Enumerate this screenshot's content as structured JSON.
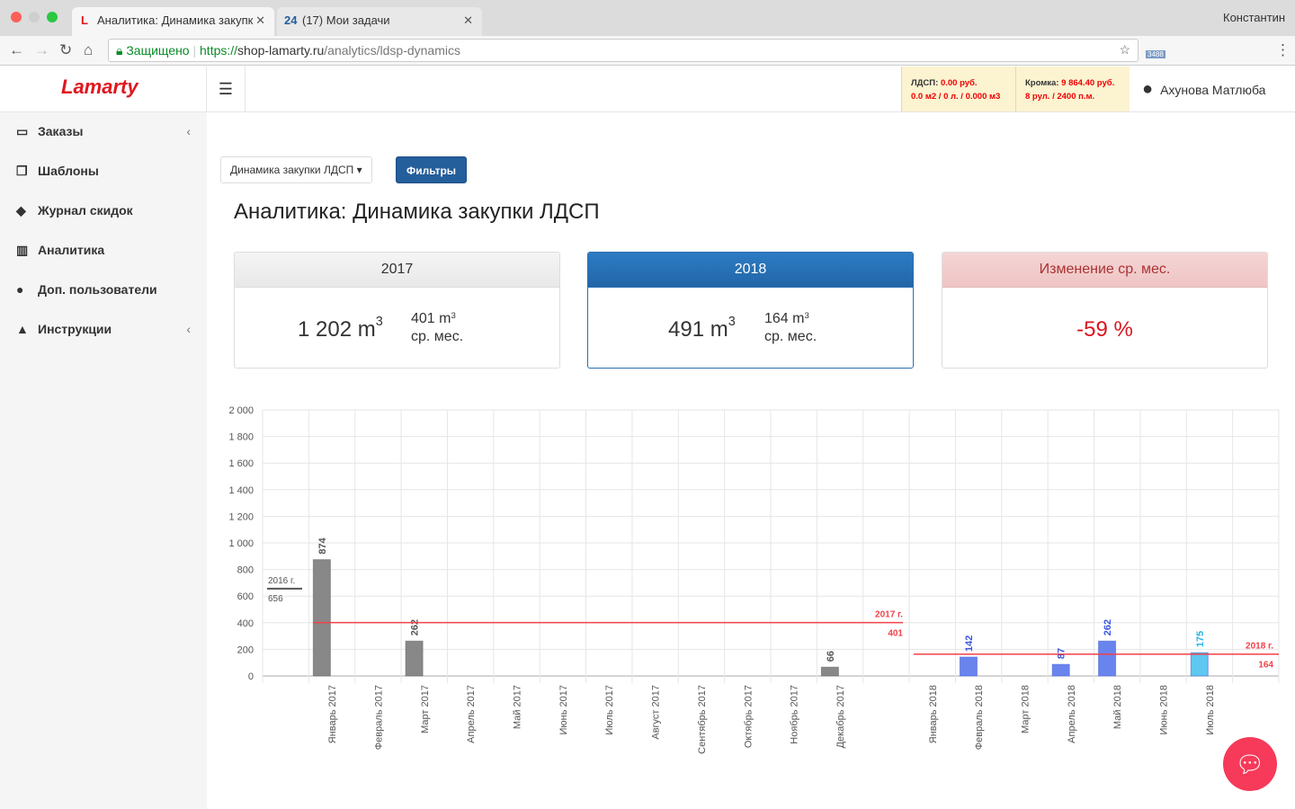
{
  "browser": {
    "tabs": [
      {
        "title": "Аналитика: Динамика закупк",
        "icon": "L"
      },
      {
        "title": "(17) Мои задачи",
        "icon": "24"
      }
    ],
    "profile": "Константин",
    "secure_label": "Защищено",
    "url_scheme": "https://",
    "url_host": "shop-lamarty.ru",
    "url_path": "/analytics/ldsp-dynamics",
    "ext_badge": "3488"
  },
  "header": {
    "logo": "Lamarty",
    "ldsp_label": "ЛДСП:",
    "ldsp_price": "0.00 руб.",
    "ldsp_detail": "0.0 м2 / 0 л. / 0.000 м3",
    "edge_label": "Кромка:",
    "edge_price": "9 864.40 руб.",
    "edge_detail": "8 рул. / 2400 п.м.",
    "user": "Ахунова Матлюба"
  },
  "sidebar": {
    "items": [
      {
        "label": "Заказы",
        "icon": "inbox-icon",
        "glyph": "▭",
        "chevron": true
      },
      {
        "label": "Шаблоны",
        "icon": "copy-icon",
        "glyph": "❐"
      },
      {
        "label": "Журнал скидок",
        "icon": "tags-icon",
        "glyph": "◆"
      },
      {
        "label": "Аналитика",
        "icon": "bar-chart-icon",
        "glyph": "▥"
      },
      {
        "label": "Доп. пользователи",
        "icon": "users-icon",
        "glyph": "●"
      },
      {
        "label": "Инструкции",
        "icon": "warning-icon",
        "glyph": "▲",
        "chevron": true
      }
    ]
  },
  "toolbar": {
    "dropdown": "Динамика закупки ЛДСП",
    "filters": "Фильтры"
  },
  "page_title": "Аналитика: Динамика закупки ЛДСП",
  "cards": [
    {
      "title": "2017",
      "total": "1 202 m",
      "avg": "401 m",
      "avg_label": "ср. мес."
    },
    {
      "title": "2018",
      "total": "491 m",
      "avg": "164 m",
      "avg_label": "ср. мес."
    },
    {
      "title": "Изменение ср. мес.",
      "value": "-59 %"
    }
  ],
  "chart_data": {
    "type": "bar",
    "ylim": [
      0,
      2000
    ],
    "yticks": [
      "0",
      "200",
      "400",
      "600",
      "800",
      "1 000",
      "1 200",
      "1 400",
      "1 600",
      "1 800",
      "2 000"
    ],
    "categories": [
      "",
      "Январь 2017",
      "Февраль 2017",
      "Март 2017",
      "Апрель 2017",
      "Май 2017",
      "Июнь 2017",
      "Июль 2017",
      "Август 2017",
      "Сентябрь 2017",
      "Октябрь 2017",
      "Ноябрь 2017",
      "Декабрь 2017",
      "",
      "Январь 2018",
      "Февраль 2018",
      "Март 2018",
      "Апрель 2018",
      "Май 2018",
      "Июнь 2018",
      "Июль 2018",
      ""
    ],
    "values": [
      null,
      874,
      null,
      262,
      null,
      null,
      null,
      null,
      null,
      null,
      null,
      null,
      66,
      null,
      null,
      142,
      null,
      87,
      262,
      null,
      175,
      null
    ],
    "colors": {
      "2017": "#888888",
      "2018": "#6a84ee",
      "current": "#5ec8f0",
      "avg": "#f0424a",
      "ref2016": "#555555"
    },
    "averages": [
      {
        "label": "2016 г.",
        "value": 656
      },
      {
        "label": "2017 г.",
        "value": 401
      },
      {
        "label": "2018 г.",
        "value": 164
      }
    ]
  }
}
